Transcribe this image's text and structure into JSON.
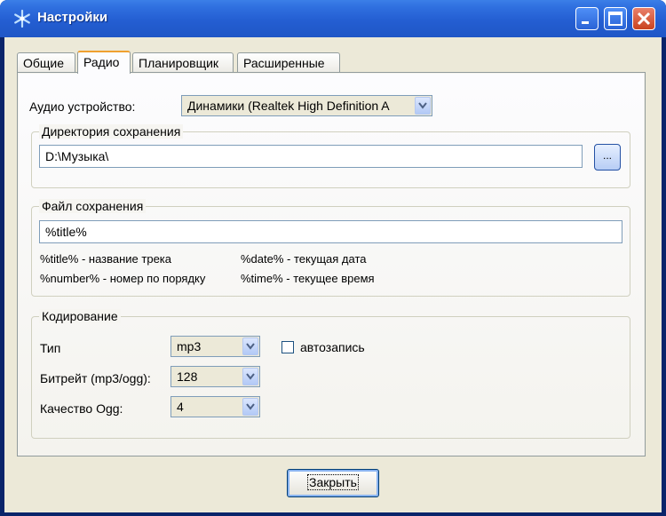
{
  "window": {
    "title": "Настройки",
    "controls": {
      "minimize": "minimize-icon",
      "maximize": "maximize-icon",
      "close": "close-icon"
    }
  },
  "tabs": [
    {
      "label": "Общие",
      "active": false
    },
    {
      "label": "Радио",
      "active": true
    },
    {
      "label": "Планировщик",
      "active": false
    },
    {
      "label": "Расширенные",
      "active": false
    }
  ],
  "audio": {
    "label": "Аудио устройство:",
    "value": "Динамики (Realtek High Definition A"
  },
  "save_dir": {
    "legend": "Директория сохранения",
    "value": "D:\\Музыка\\",
    "browse_label": "..."
  },
  "save_file": {
    "legend": "Файл сохранения",
    "value": "%title%",
    "hints": [
      "%title% - название трека",
      "%date% - текущая дата",
      "%number% - номер по порядку",
      "%time% - текущее время"
    ]
  },
  "encoding": {
    "legend": "Кодирование",
    "type_label": "Тип",
    "type_value": "mp3",
    "bitrate_label": "Битрейт (mp3/ogg):",
    "bitrate_value": "128",
    "quality_label": "Качество Ogg:",
    "quality_value": "4",
    "autorecord_label": "автозапись",
    "autorecord_checked": false
  },
  "footer": {
    "close_label": "Закрыть"
  },
  "colors": {
    "titlebar": "#245ed2",
    "client": "#ece9d8",
    "accent_tab": "#f0a030"
  }
}
